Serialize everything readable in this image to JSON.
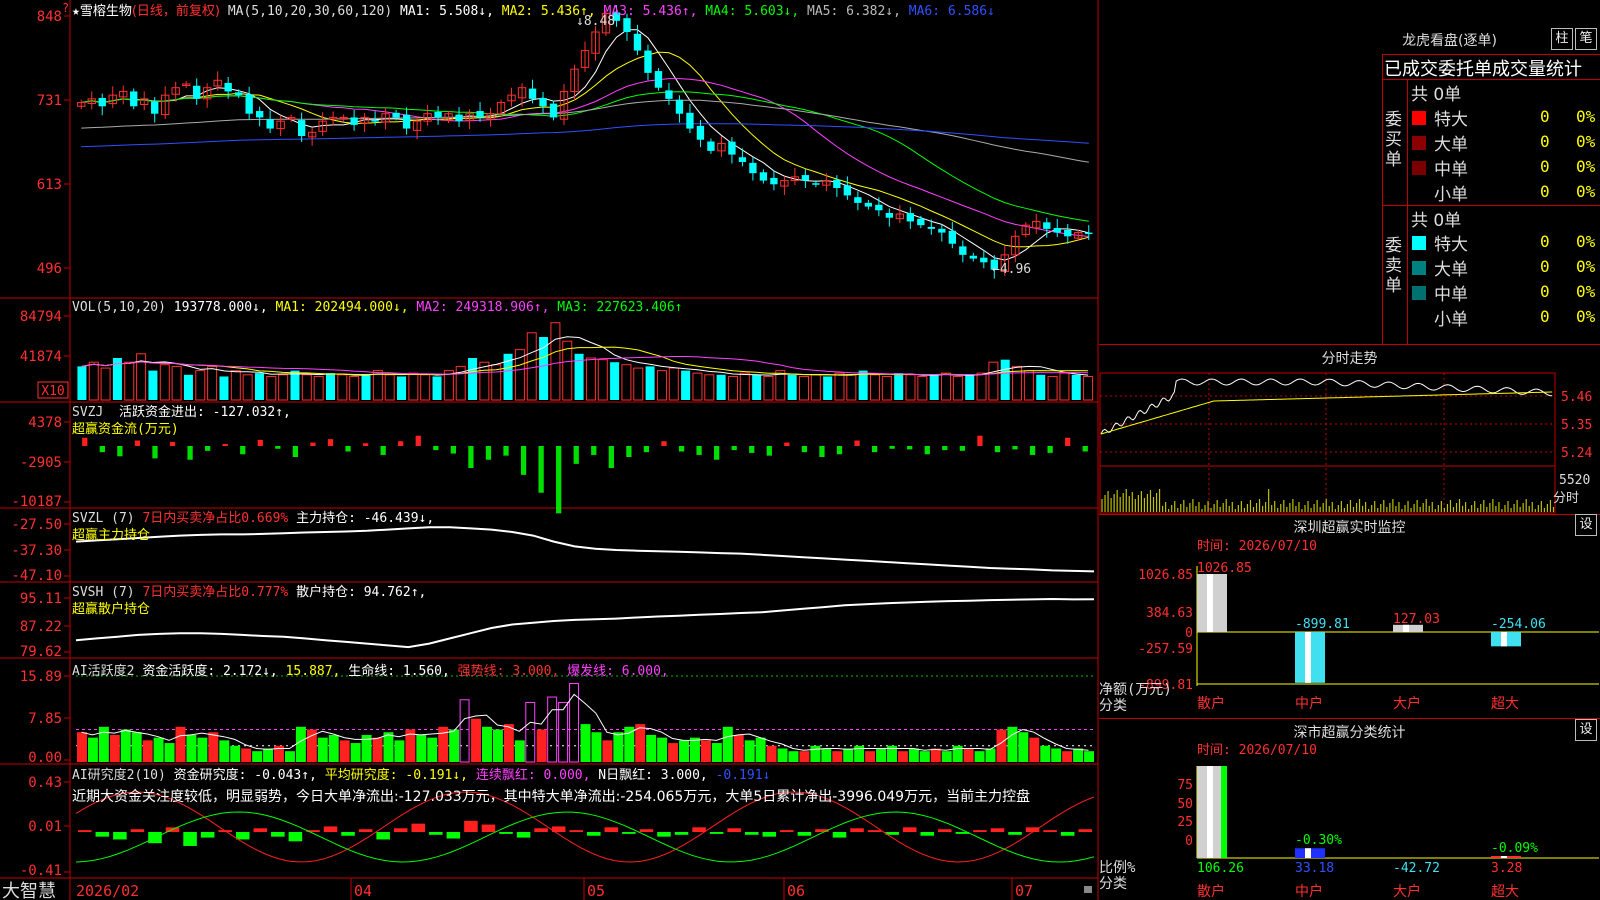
{
  "main_header": {
    "star": "★",
    "stock_name": "雪榕生物",
    "period": "(日线，前复权)",
    "ma_label": "MA(5,10,20,30,60,120)",
    "ma1": "MA1: 5.508↓,",
    "ma2": "MA2: 5.436↑,",
    "ma3": "MA3: 5.436↑,",
    "ma4": "MA4: 5.603↓,",
    "ma5": "MA5: 6.382↓,",
    "ma6": "MA6: 6.586↓",
    "price_high": "8.48",
    "price_low": "4.96"
  },
  "vol_header": {
    "label": "VOL(5,10,20)",
    "v": "193778.000↓,",
    "ma1": "MA1: 202494.000↓,",
    "ma2": "MA2: 249318.906↑,",
    "ma3": "MA3: 227623.406↑"
  },
  "svzj_header": {
    "label": "SVZJ",
    "t1": "活跃资金进出: -127.032↑,",
    "t2": "超赢资金流(万元)"
  },
  "svzl_header": {
    "label": "SVZL (7)",
    "t1": "7日内买卖净占比0.669%",
    "t2": "主力持仓: -46.439↓,",
    "t3": "超赢主力持仓"
  },
  "svsh_header": {
    "label": "SVSH (7)",
    "t1": "7日内买卖净占比0.777%",
    "t2": "散户持仓: 94.762↑,",
    "t3": "超赢散户持仓"
  },
  "ai_header": {
    "label": "AI活跃度2",
    "t1": "资金活跃度: 2.172↓,",
    "t2": "15.887,",
    "t3": "生命线: 1.560,",
    "t4": "强势线: 3.000,",
    "t5": "爆发线: 6.000,"
  },
  "ai2_header": {
    "label": "AI研究度2(10)",
    "t1": "资金研究度: -0.043↑,",
    "t2": "平均研究度: -0.191↓,",
    "t3": "连续飘红: 0.000,",
    "t4": "N日飘红: 3.000,",
    "t5": "-0.191↓"
  },
  "ai2_comment": "近期大资金关注度较低，明显弱势，今日大单净流出:-127.033万元，其中特大单净流出:-254.065万元，大单5日累计净出-3996.049万元，当前主力控盘",
  "y_axes": {
    "main": [
      "848",
      "731",
      "613",
      "496"
    ],
    "vol": [
      "84794",
      "41874",
      "X10"
    ],
    "svzj": [
      "4378",
      "-2905",
      "-10187"
    ],
    "svzl": [
      "-27.50",
      "-37.30",
      "-47.10"
    ],
    "svsh": [
      "95.11",
      "87.22",
      "79.62"
    ],
    "ai": [
      "15.89",
      "7.85",
      "0.00"
    ],
    "ai2": [
      "0.43",
      "0.01",
      "-0.41"
    ]
  },
  "x_axis": {
    "brand": "大智慧",
    "labels": [
      "2026/02",
      "04",
      "05",
      "06",
      "07"
    ]
  },
  "dragon": {
    "title": "龙虎看盘(逐单)",
    "btn_tick": "柱",
    "btn_order": "笔",
    "heading": "已成交委托单成交量统计",
    "buy": {
      "side": "委买单",
      "total": "共 0单",
      "rows": [
        {
          "label": "特大",
          "v": "0",
          "p": "0%"
        },
        {
          "label": "大单",
          "v": "0",
          "p": "0%"
        },
        {
          "label": "中单",
          "v": "0",
          "p": "0%"
        },
        {
          "label": "小单",
          "v": "0",
          "p": "0%"
        }
      ]
    },
    "sell": {
      "side": "委卖单",
      "total": "共 0单",
      "rows": [
        {
          "label": "特大",
          "v": "0",
          "p": "0%"
        },
        {
          "label": "大单",
          "v": "0",
          "p": "0%"
        },
        {
          "label": "中单",
          "v": "0",
          "p": "0%"
        },
        {
          "label": "小单",
          "v": "0",
          "p": "0%"
        }
      ]
    },
    "colors": {
      "buy1": "#ff0000",
      "buy2": "#8b0000",
      "buy3": "#7a0000",
      "sell1": "#00ffff",
      "sell2": "#008080",
      "sell3": "#007070"
    }
  },
  "intraday": {
    "title": "分时走势",
    "prices": [
      "5.46",
      "5.35",
      "5.24"
    ],
    "vol_max": "5520",
    "vol_unit": "分时"
  },
  "sz_monitor": {
    "title": "深圳超赢实时监控",
    "set_btn": "设",
    "time": "时间: 2026/07/10",
    "yticks": [
      "1026.85",
      "384.63",
      "0",
      "-257.59",
      "-899.81"
    ],
    "ylabel": "净额(万元)",
    "xlabel": "分类",
    "categories": [
      "散户",
      "中户",
      "大户",
      "超大"
    ],
    "values": [
      1026.85,
      -899.81,
      127.03,
      -254.06
    ],
    "value_labels": [
      "1026.85",
      "-899.81",
      "127.03",
      "-254.06"
    ]
  },
  "sz_class": {
    "title": "深市超赢分类统计",
    "set_btn": "设",
    "time": "时间: 2026/07/10",
    "yticks": [
      "75",
      "50",
      "25",
      "0"
    ],
    "ylabel": "比例%",
    "xlabel": "分类",
    "categories": [
      "散户",
      "中户",
      "大户",
      "超大"
    ],
    "values": [
      106.26,
      33.18,
      -42.72,
      3.28
    ],
    "pct_labels": [
      "",
      "-0.30%",
      "",
      "-0.09%"
    ],
    "bottom_labels": [
      "106.26",
      "33.18",
      "-42.72",
      "3.28"
    ]
  },
  "chart_data": [
    {
      "type": "candlestick",
      "title": "雪榕生物 (日线，前复权)",
      "yticks": [
        8.48,
        7.31,
        6.13,
        4.96
      ],
      "ylim": [
        4.7,
        8.55
      ],
      "annotations": [
        {
          "text": "8.48",
          "value": 8.48
        },
        {
          "text": "4.96",
          "value": 4.96
        }
      ],
      "close_series": [
        7.25,
        7.3,
        7.2,
        7.35,
        7.4,
        7.2,
        7.3,
        7.1,
        7.35,
        7.45,
        7.5,
        7.3,
        7.45,
        7.55,
        7.4,
        7.35,
        7.1,
        7.05,
        6.9,
        7.0,
        7.05,
        6.8,
        6.85,
        7.0,
        7.05,
        7.05,
        6.95,
        7.05,
        7.0,
        7.1,
        7.05,
        6.9,
        7.0,
        7.1,
        7.05,
        7.1,
        7.0,
        7.1,
        7.05,
        7.1,
        7.25,
        7.35,
        7.45,
        7.3,
        7.2,
        7.05,
        7.4,
        7.7,
        7.95,
        8.2,
        8.45,
        8.35,
        8.2,
        7.95,
        7.65,
        7.45,
        7.3,
        7.1,
        6.9,
        6.75,
        6.6,
        6.7,
        6.55,
        6.45,
        6.3,
        6.2,
        6.15,
        6.2,
        6.25,
        6.2,
        6.15,
        6.2,
        6.1,
        6.0,
        5.9,
        5.85,
        5.8,
        5.7,
        5.75,
        5.65,
        5.6,
        5.55,
        5.5,
        5.35,
        5.2,
        5.15,
        5.1,
        5.0,
        5.2,
        5.45,
        5.6,
        5.65,
        5.55,
        5.5,
        5.45,
        5.5,
        5.48
      ]
    },
    {
      "type": "bar",
      "title": "VOL(5,10,20)",
      "yticks": [
        84794,
        41874
      ],
      "values": [
        40,
        45,
        38,
        50,
        45,
        55,
        35,
        42,
        40,
        30,
        35,
        40,
        28,
        35,
        30,
        32,
        28,
        30,
        35,
        30,
        28,
        32,
        30,
        28,
        30,
        35,
        30,
        28,
        32,
        30,
        28,
        35,
        40,
        50,
        45,
        42,
        55,
        60,
        80,
        75,
        92,
        70,
        55,
        50,
        48,
        45,
        42,
        38,
        40,
        35,
        38,
        35,
        32,
        30,
        30,
        28,
        32,
        30,
        28,
        35,
        30,
        28,
        30,
        28,
        32,
        30,
        35,
        30,
        28,
        32,
        30,
        28,
        30,
        32,
        28,
        30,
        32,
        45,
        48,
        40,
        35,
        30,
        28,
        32,
        30,
        28
      ]
    },
    {
      "type": "bar",
      "title": "SVZJ 超赢资金流(万元)",
      "yticks": [
        4378,
        -2905,
        -10187
      ],
      "values": [
        1200,
        -900,
        -1500,
        800,
        -1800,
        600,
        -2000,
        -700,
        300,
        -1200,
        900,
        -400,
        -1600,
        500,
        1000,
        -800,
        400,
        -1300,
        700,
        1500,
        -600,
        -1100,
        -3200,
        -2000,
        -1400,
        -4200,
        -6800,
        -9800,
        -2600,
        -1300,
        -3200,
        -1600,
        -900,
        700,
        -800,
        -1300,
        -2000,
        -600,
        -1000,
        -1400,
        500,
        -900,
        -1600,
        -1200,
        800,
        -900,
        -400,
        -500,
        -1200,
        -600,
        -700,
        1500,
        -900,
        -500,
        -1300,
        -1000,
        1200,
        -800
      ]
    },
    {
      "type": "line",
      "title": "SVZL 超赢主力持仓",
      "yticks": [
        -27.5,
        -37.3,
        -47.1
      ],
      "values": [
        -34.0,
        -33.5,
        -33.0,
        -32.5,
        -32.0,
        -31.5,
        -31.2,
        -31.0,
        -31.0,
        -30.8,
        -30.5,
        -30.2,
        -30.0,
        -29.8,
        -29.5,
        -29.0,
        -28.5,
        -28.0,
        -28.0,
        -28.5,
        -29.0,
        -30.0,
        -31.5,
        -34.0,
        -36.0,
        -37.0,
        -37.5,
        -37.8,
        -38.0,
        -38.2,
        -38.5,
        -38.8,
        -39.0,
        -39.5,
        -40.0,
        -40.5,
        -41.0,
        -41.5,
        -42.0,
        -42.5,
        -43.0,
        -43.5,
        -44.0,
        -44.5,
        -45.0,
        -45.3,
        -45.6,
        -46.0,
        -46.2,
        -46.4
      ]
    },
    {
      "type": "line",
      "title": "SVSH 超赢散户持仓",
      "yticks": [
        95.11,
        87.22,
        79.62
      ],
      "values": [
        83.0,
        83.5,
        84.0,
        84.5,
        84.8,
        85.0,
        85.0,
        84.8,
        84.5,
        84.2,
        84.0,
        83.5,
        83.0,
        82.5,
        82.0,
        81.5,
        81.0,
        82.0,
        83.5,
        85.0,
        86.5,
        87.5,
        88.0,
        88.5,
        88.8,
        89.0,
        89.2,
        89.5,
        89.8,
        90.0,
        90.3,
        90.5,
        90.8,
        91.0,
        91.5,
        92.0,
        92.5,
        93.0,
        93.3,
        93.6,
        93.8,
        94.0,
        94.2,
        94.3,
        94.5,
        94.6,
        94.7,
        94.8,
        94.7,
        94.76
      ]
    },
    {
      "type": "bar",
      "title": "AI活跃度2 资金活跃度",
      "yticks": [
        15.89,
        7.85,
        0.0
      ],
      "reference_lines": [
        {
          "name": "强势线",
          "value": 3.0
        },
        {
          "name": "爆发线",
          "value": 6.0
        }
      ],
      "values": [
        5.5,
        4.5,
        6.5,
        5.0,
        6.0,
        5.5,
        4.0,
        4.5,
        3.5,
        6.5,
        5.0,
        4.5,
        5.5,
        4.0,
        3.0,
        2.5,
        2.0,
        2.5,
        3.0,
        2.0,
        6.5,
        6.0,
        4.5,
        5.0,
        4.0,
        3.5,
        5.0,
        4.5,
        5.5,
        4.0,
        6.0,
        5.0,
        4.5,
        6.5,
        6.0,
        11.5,
        8.0,
        6.5,
        6.0,
        7.0,
        4.0,
        11.0,
        6.0,
        12.0,
        11.0,
        14.5,
        7.0,
        5.5,
        4.0,
        5.5,
        6.5,
        7.0,
        5.0,
        4.5,
        3.5,
        4.0,
        4.5,
        4.0,
        3.5,
        6.5,
        5.0,
        4.0,
        4.5,
        3.0,
        2.5,
        2.0,
        2.0,
        3.0,
        2.5,
        2.0,
        2.5,
        3.0,
        2.0,
        2.5,
        3.0,
        2.0,
        2.5,
        2.0,
        2.5,
        2.0,
        3.0,
        2.5,
        2.0,
        2.5,
        6.0,
        6.5,
        5.5,
        4.5,
        3.0,
        2.5,
        2.0,
        2.5,
        2.0
      ]
    },
    {
      "type": "bar",
      "title": "AI研究度2(10)",
      "yticks": [
        0.43,
        0.01,
        -0.41
      ],
      "values": [
        0.02,
        -0.05,
        -0.08,
        0.03,
        -0.12,
        0.05,
        -0.15,
        -0.06,
        0.02,
        -0.08,
        0.04,
        -0.05,
        -0.1,
        0.02,
        0.06,
        -0.04,
        0.03,
        -0.08,
        0.04,
        0.09,
        -0.03,
        -0.07,
        0.12,
        0.08,
        -0.02,
        -0.06,
        0.04,
        0.06,
        0.02,
        -0.04,
        0.05,
        -0.02,
        0.03,
        -0.05,
        -0.03,
        0.05,
        -0.02,
        0.04,
        -0.03,
        -0.05,
        0.02,
        -0.04,
        0.03,
        -0.06,
        0.04,
        0.02,
        -0.03,
        0.05,
        -0.04,
        0.03,
        -0.02,
        0.02,
        0.04,
        -0.03,
        0.05,
        0.02,
        -0.04,
        0.03
      ]
    }
  ]
}
